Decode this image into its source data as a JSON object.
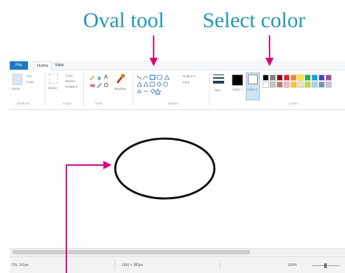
{
  "callouts": {
    "oval_tool": "Oval tool",
    "select_color": "Select color"
  },
  "menu": {
    "file": "File",
    "home": "Home",
    "view": "View"
  },
  "ribbon": {
    "clipboard": {
      "paste": "Paste",
      "cut": "Cut",
      "copy": "Copy",
      "group": "Clipboard"
    },
    "image": {
      "select": "Select",
      "crop": "Crop",
      "resize": "Resize",
      "rotate": "Rotate ▾",
      "group": "Image"
    },
    "tools": {
      "group": "Tools",
      "text_glyph": "A"
    },
    "brushes": "Brushes",
    "shapes": {
      "outline": "Outline ▾",
      "fill": "Fill ▾",
      "group": "Shapes"
    },
    "size": "Size",
    "color1": "Color 1",
    "color2": "Color 2",
    "colors_group": "Colors"
  },
  "palette": {
    "row1": [
      "#000000",
      "#7f7f7f",
      "#880015",
      "#ed1c24",
      "#ff7f27",
      "#fff200",
      "#22b14c",
      "#00a2e8",
      "#3f48cc",
      "#a349a4"
    ],
    "row2": [
      "#ffffff",
      "#c3c3c3",
      "#b97a57",
      "#ffaec9",
      "#ffc90e",
      "#efe4b0",
      "#b5e61d",
      "#99d9ea",
      "#7092be",
      "#c8bfe7"
    ]
  },
  "status": {
    "cursor_pos": "729, 141px",
    "canvas_size": "1366 × 383px",
    "zoom": "100%"
  },
  "colors": {
    "accent": "#1979ca",
    "callout_text": "#1e9ab8",
    "arrow": "#e4007f"
  }
}
